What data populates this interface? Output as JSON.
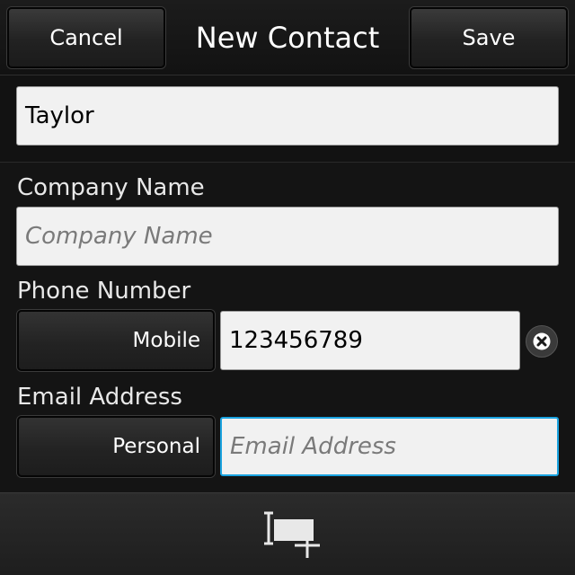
{
  "titlebar": {
    "cancel_label": "Cancel",
    "title": "New Contact",
    "save_label": "Save"
  },
  "name": {
    "value": "Taylor"
  },
  "company": {
    "label": "Company Name",
    "placeholder": "Company Name"
  },
  "phone": {
    "label": "Phone Number",
    "type": "Mobile",
    "value": "123456789"
  },
  "email": {
    "label": "Email Address",
    "type": "Personal",
    "placeholder": "Email Address"
  },
  "bottombar": {
    "icon": "add-field-icon"
  },
  "colors": {
    "focus": "#1aa3e0",
    "background": "#151515"
  }
}
